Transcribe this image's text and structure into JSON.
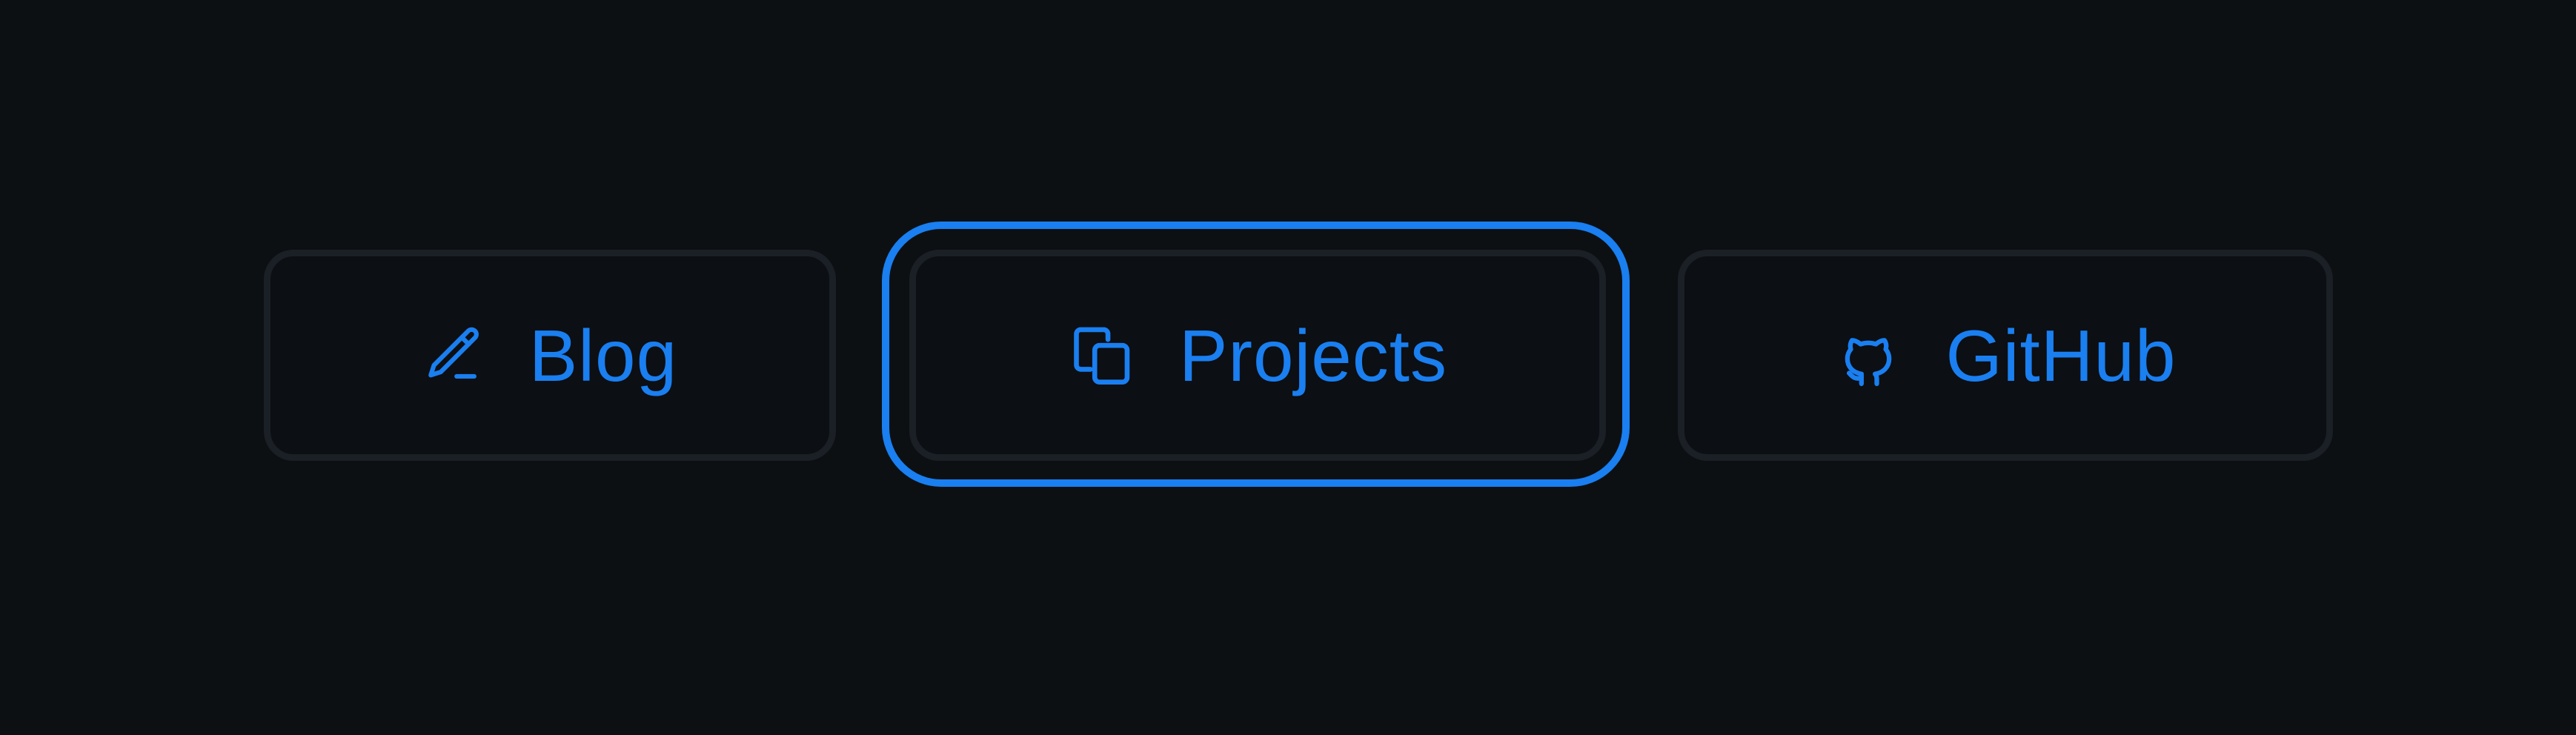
{
  "nav": {
    "items": [
      {
        "label": "Blog",
        "icon": "pencil-icon",
        "focused": false
      },
      {
        "label": "Projects",
        "icon": "copy-icon",
        "focused": true
      },
      {
        "label": "GitHub",
        "icon": "github-octocat-icon",
        "focused": false
      }
    ]
  },
  "colors": {
    "background": "#0d1013",
    "button_background": "#0c0f13",
    "button_border": "#1b1f26",
    "accent": "#1a7ff0"
  }
}
